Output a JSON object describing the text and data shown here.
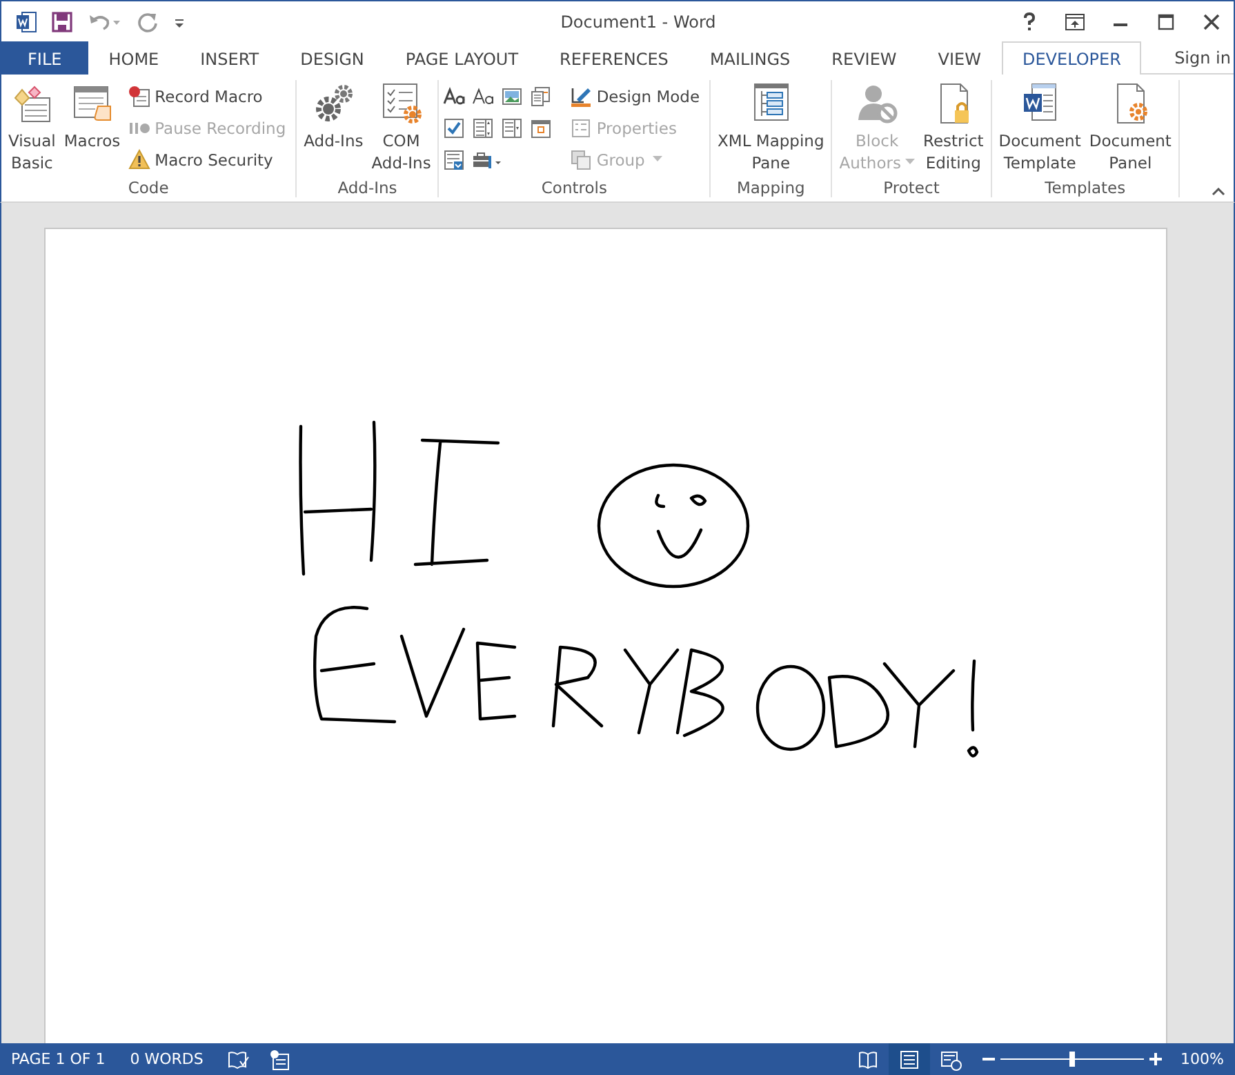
{
  "window": {
    "title": "Document1 - Word"
  },
  "tabs": [
    {
      "label": "FILE",
      "kind": "file",
      "selected": false
    },
    {
      "label": "HOME",
      "kind": "tab",
      "selected": false
    },
    {
      "label": "INSERT",
      "kind": "tab",
      "selected": false
    },
    {
      "label": "DESIGN",
      "kind": "tab",
      "selected": false
    },
    {
      "label": "PAGE LAYOUT",
      "kind": "tab",
      "selected": false
    },
    {
      "label": "REFERENCES",
      "kind": "tab",
      "selected": false
    },
    {
      "label": "MAILINGS",
      "kind": "tab",
      "selected": false
    },
    {
      "label": "REVIEW",
      "kind": "tab",
      "selected": false
    },
    {
      "label": "VIEW",
      "kind": "tab",
      "selected": false
    },
    {
      "label": "DEVELOPER",
      "kind": "tab",
      "selected": true
    }
  ],
  "sign_in": "Sign in",
  "ribbon": {
    "groups": [
      {
        "label": "Code",
        "items": [
          {
            "kind": "large",
            "label": "Visual\nBasic",
            "disabled": false,
            "dropdown": false
          },
          {
            "kind": "large",
            "label": "Macros",
            "disabled": false,
            "dropdown": false
          },
          {
            "kind": "small",
            "label": "Record Macro",
            "disabled": false,
            "dropdown": false
          },
          {
            "kind": "small",
            "label": "Pause Recording",
            "disabled": true,
            "dropdown": false
          },
          {
            "kind": "small",
            "label": "Macro Security",
            "disabled": false,
            "dropdown": false
          }
        ]
      },
      {
        "label": "Add-Ins",
        "items": [
          {
            "kind": "large",
            "label": "Add-Ins",
            "disabled": false,
            "dropdown": false
          },
          {
            "kind": "large",
            "label": "COM\nAdd-Ins",
            "disabled": false,
            "dropdown": false
          }
        ]
      },
      {
        "label": "Controls",
        "items": [
          {
            "kind": "grid"
          },
          {
            "kind": "small",
            "label": "Design Mode",
            "disabled": false,
            "dropdown": false
          },
          {
            "kind": "small",
            "label": "Properties",
            "disabled": true,
            "dropdown": false
          },
          {
            "kind": "small",
            "label": "Group",
            "disabled": true,
            "dropdown": true
          }
        ]
      },
      {
        "label": "Mapping",
        "items": [
          {
            "kind": "large",
            "label": "XML Mapping\nPane",
            "disabled": false,
            "dropdown": false
          }
        ]
      },
      {
        "label": "Protect",
        "items": [
          {
            "kind": "large",
            "label": "Block\nAuthors",
            "disabled": true,
            "dropdown": true
          },
          {
            "kind": "large",
            "label": "Restrict\nEditing",
            "disabled": false,
            "dropdown": false
          }
        ]
      },
      {
        "label": "Templates",
        "items": [
          {
            "kind": "large",
            "label": "Document\nTemplate",
            "disabled": false,
            "dropdown": false
          },
          {
            "kind": "large",
            "label": "Document\nPanel",
            "disabled": false,
            "dropdown": false
          }
        ]
      }
    ]
  },
  "status_bar": {
    "page": "PAGE 1 OF 1",
    "words": "0 WORDS",
    "views": [
      {
        "kind": "read",
        "selected": false
      },
      {
        "kind": "print",
        "selected": true
      },
      {
        "kind": "web",
        "selected": false
      }
    ],
    "zoom": {
      "level": 0.5,
      "reading": "100%"
    }
  }
}
